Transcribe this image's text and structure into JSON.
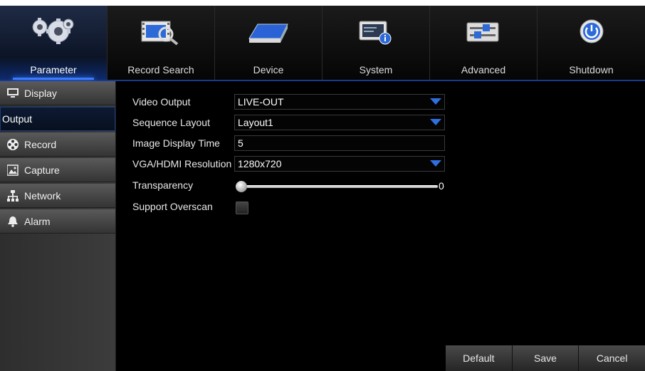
{
  "top_tabs": [
    {
      "label": "Parameter",
      "icon": "gears-icon",
      "active": true
    },
    {
      "label": "Record Search",
      "icon": "film-search-icon",
      "active": false
    },
    {
      "label": "Device",
      "icon": "hard-drive-icon",
      "active": false
    },
    {
      "label": "System",
      "icon": "system-info-icon",
      "active": false
    },
    {
      "label": "Advanced",
      "icon": "sliders-icon",
      "active": false
    },
    {
      "label": "Shutdown",
      "icon": "power-icon",
      "active": false
    }
  ],
  "sidebar": {
    "items": [
      {
        "label": "Display",
        "icon": "monitor-icon"
      },
      {
        "label": "Output",
        "icon": ""
      },
      {
        "label": "Record",
        "icon": "film-reel-icon"
      },
      {
        "label": "Capture",
        "icon": "image-icon"
      },
      {
        "label": "Network",
        "icon": "network-icon"
      },
      {
        "label": "Alarm",
        "icon": "bell-icon"
      }
    ],
    "active_index": 1
  },
  "form": {
    "video_output": {
      "label": "Video Output",
      "value": "LIVE-OUT"
    },
    "sequence_layout": {
      "label": "Sequence Layout",
      "value": "Layout1"
    },
    "image_display_time": {
      "label": "Image Display Time",
      "value": "5"
    },
    "resolution": {
      "label": "VGA/HDMI Resolution",
      "value": "1280x720"
    },
    "transparency": {
      "label": "Transparency",
      "value": "0",
      "level": 0
    },
    "support_overscan": {
      "label": "Support Overscan",
      "checked": false
    }
  },
  "buttons": {
    "default_label": "Default",
    "save_label": "Save",
    "cancel_label": "Cancel"
  },
  "colors": {
    "accent": "#3c7bff",
    "dropdown_arrow": "#2f6fe0"
  }
}
